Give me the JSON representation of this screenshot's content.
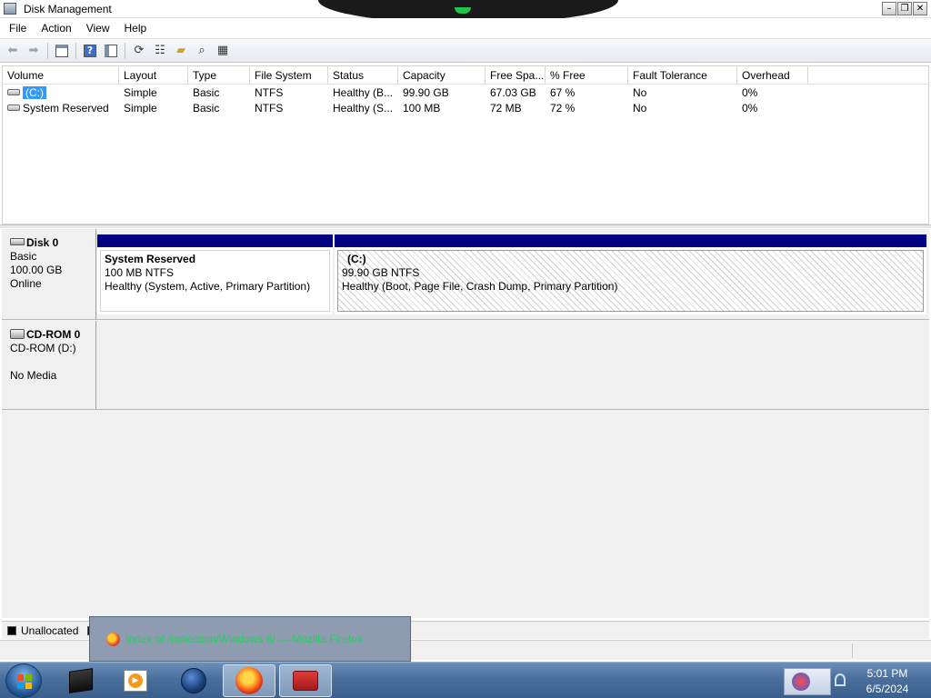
{
  "window": {
    "title": "Disk Management"
  },
  "menu": [
    "File",
    "Action",
    "View",
    "Help"
  ],
  "toolbar": {
    "icons": [
      "back-arrow-icon",
      "forward-arrow-icon",
      "console-tree-icon",
      "help-icon",
      "show-hide-icon",
      "refresh-icon",
      "properties-icon",
      "open-folder-icon",
      "search-disk-icon",
      "export-icon"
    ]
  },
  "volume_table": {
    "columns": [
      "Volume",
      "Layout",
      "Type",
      "File System",
      "Status",
      "Capacity",
      "Free Spa...",
      "% Free",
      "Fault Tolerance",
      "Overhead"
    ],
    "rows": [
      {
        "volume": "(C:)",
        "layout": "Simple",
        "type": "Basic",
        "fs": "NTFS",
        "status": "Healthy (B...",
        "capacity": "99.90 GB",
        "free": "67.03 GB",
        "pct_free": "67 %",
        "fault": "No",
        "overhead": "0%"
      },
      {
        "volume": "System Reserved",
        "layout": "Simple",
        "type": "Basic",
        "fs": "NTFS",
        "status": "Healthy (S...",
        "capacity": "100 MB",
        "free": "72 MB",
        "pct_free": "72 %",
        "fault": "No",
        "overhead": "0%"
      }
    ]
  },
  "disks": {
    "disk0": {
      "name": "Disk 0",
      "type": "Basic",
      "size": "100.00 GB",
      "state": "Online",
      "partitions": [
        {
          "name": "System Reserved",
          "size": "100 MB NTFS",
          "status": "Healthy (System, Active, Primary Partition)"
        },
        {
          "name": "(C:)",
          "size": "99.90 GB NTFS",
          "status": "Healthy (Boot, Page File, Crash Dump, Primary Partition)"
        }
      ]
    },
    "cdrom0": {
      "name": "CD-ROM 0",
      "type": "CD-ROM (D:)",
      "state": "No Media"
    }
  },
  "legend": {
    "unallocated": "Unallocated",
    "colors": {
      "unallocated": "#000000",
      "primary": "#000080"
    }
  },
  "taskbar": {
    "preview_title": "Index of /collection/Windows 8/ — Mozilla Firefox",
    "time": "5:01 PM",
    "date": "6/5/2024"
  },
  "colors": {
    "partition_bar": "#000080",
    "selection": "#3399ff",
    "preview_text": "#1fd45a"
  }
}
